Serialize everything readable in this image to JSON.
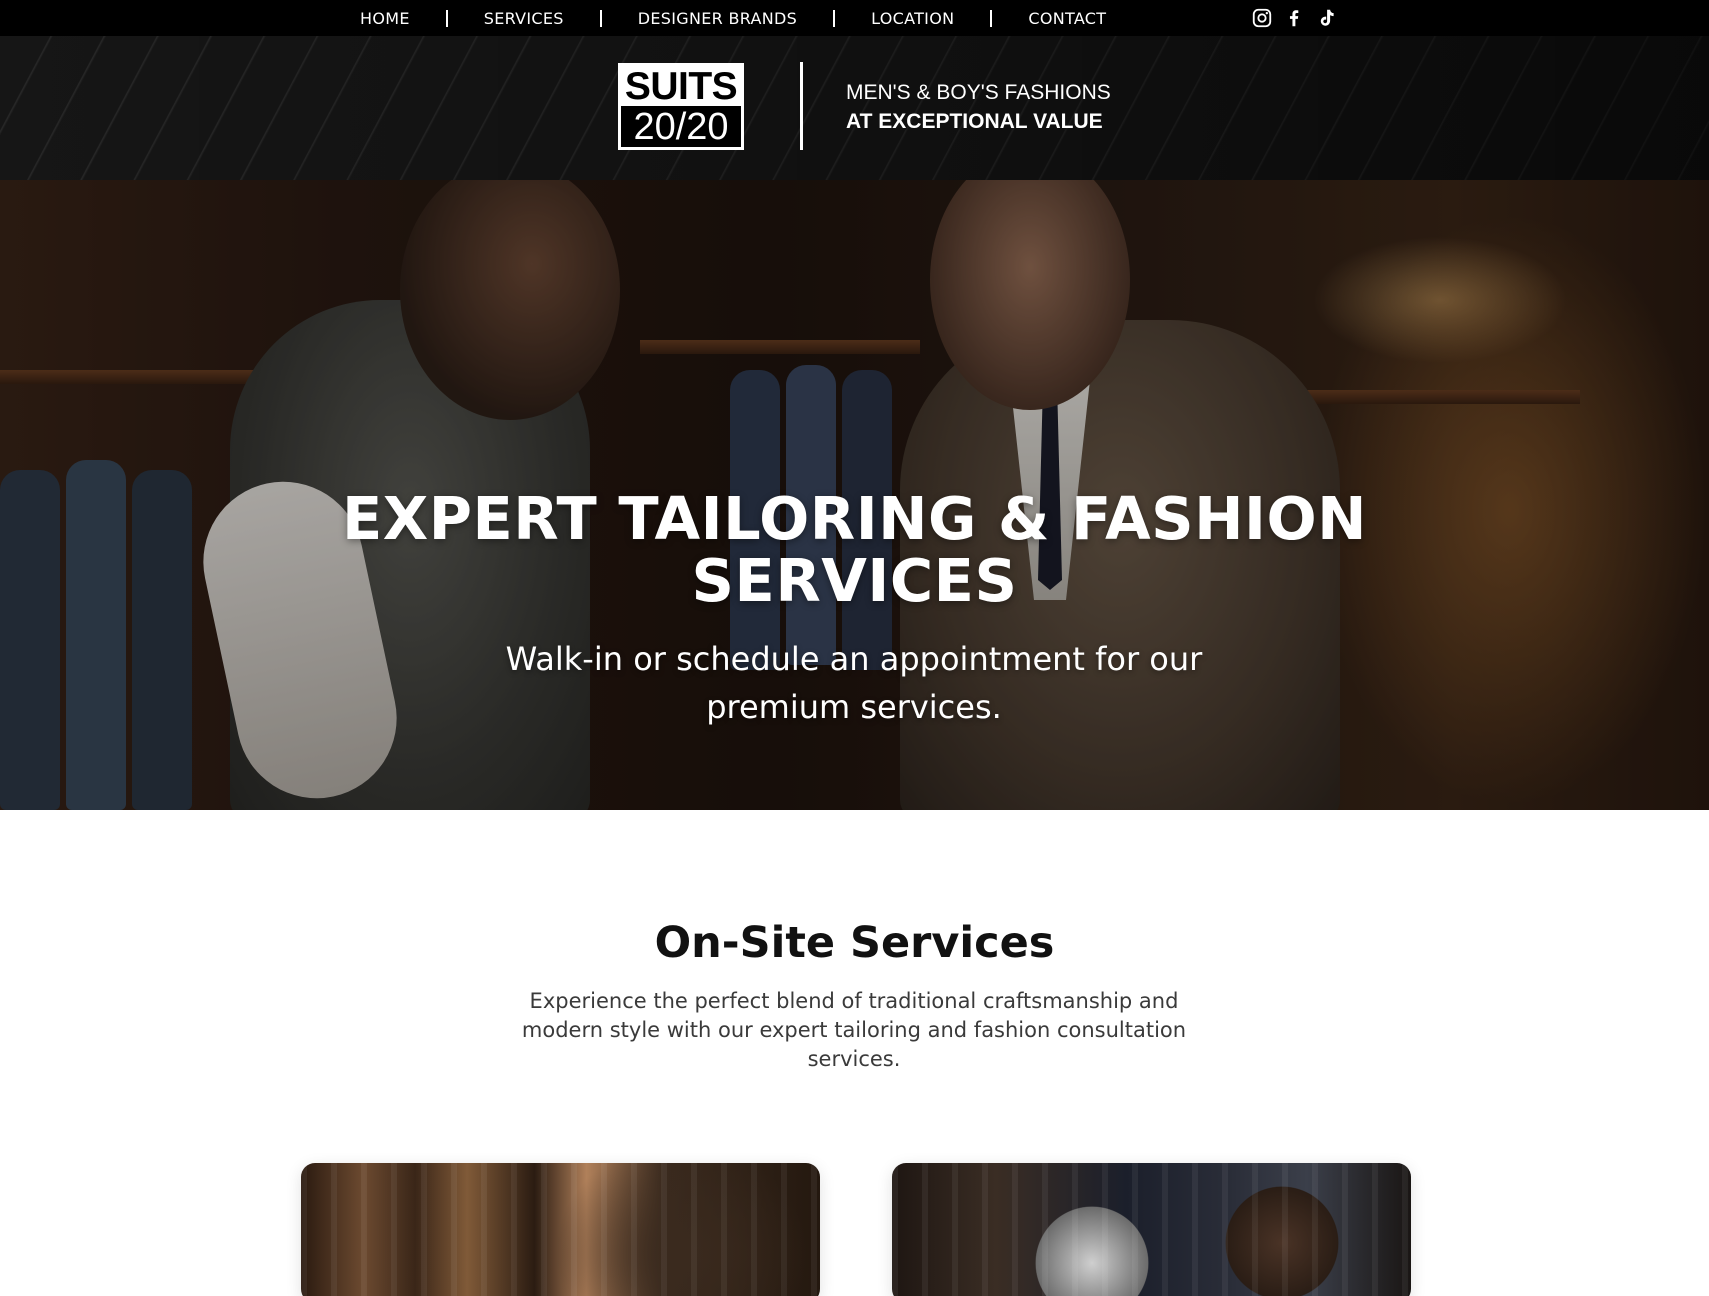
{
  "nav": {
    "items": [
      {
        "label": "HOME"
      },
      {
        "label": "SERVICES"
      },
      {
        "label": "DESIGNER BRANDS"
      },
      {
        "label": "LOCATION"
      },
      {
        "label": "CONTACT"
      }
    ],
    "social_icons": [
      "instagram-icon",
      "facebook-icon",
      "tiktok-icon"
    ]
  },
  "brand": {
    "logo_top": "SUITS",
    "logo_bottom": "20/20",
    "tagline_line1": "MEN'S & BOY'S FASHIONS",
    "tagline_line2": "AT EXCEPTIONAL VALUE"
  },
  "hero": {
    "title_line1": "EXPERT TAILORING & FASHION",
    "title_line2": "SERVICES",
    "subtitle": "Walk-in or schedule an appointment for our premium services."
  },
  "services": {
    "title": "On-Site Services",
    "description": "Experience the perfect blend of traditional craftsmanship and modern style with our expert tailoring and fashion consultation services."
  },
  "colors": {
    "nav_bg": "#000000",
    "text_on_dark": "#ffffff",
    "heading": "#111111",
    "body_text": "#3a3a3a"
  }
}
